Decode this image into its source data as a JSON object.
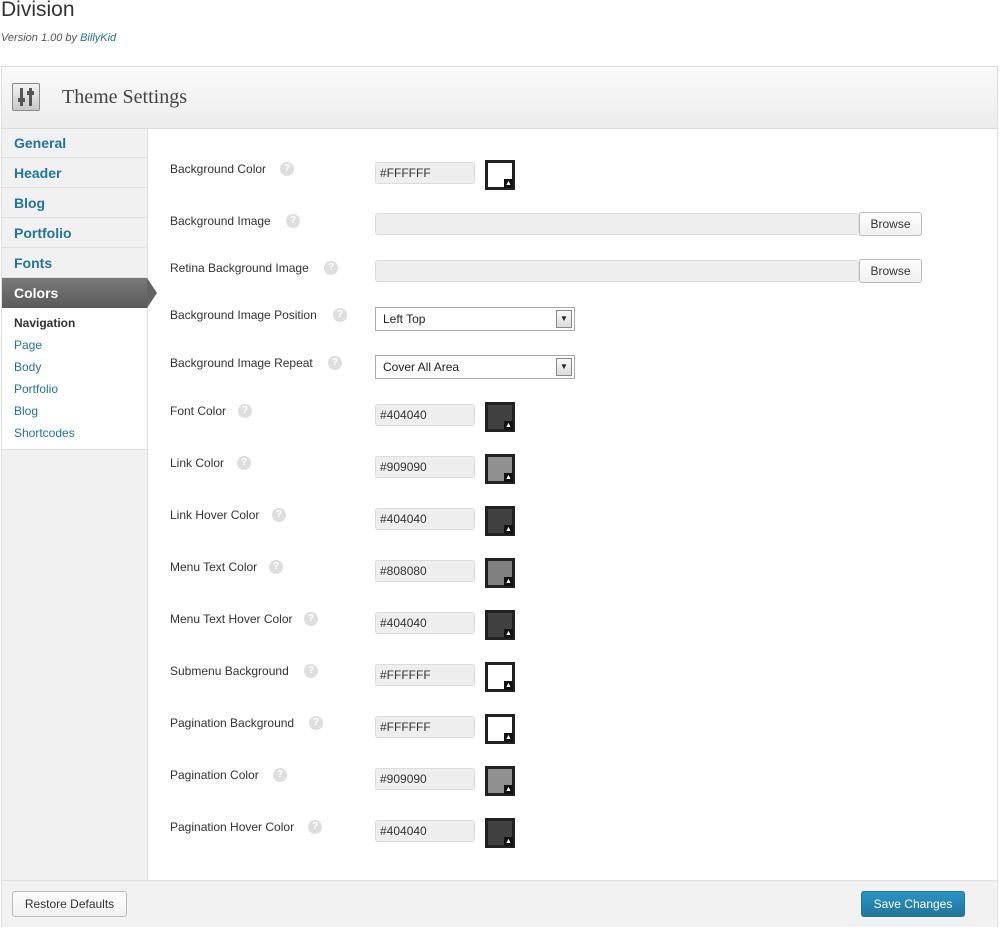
{
  "theme": {
    "name": "Division",
    "version_prefix": "Version 1.00 by",
    "author": "BillyKid"
  },
  "panel": {
    "title": "Theme Settings",
    "icon": "settings-sliders-icon"
  },
  "sidebar": {
    "items": [
      {
        "label": "General"
      },
      {
        "label": "Header"
      },
      {
        "label": "Blog"
      },
      {
        "label": "Portfolio"
      },
      {
        "label": "Fonts"
      },
      {
        "label": "Colors",
        "active": true
      }
    ],
    "subitems": [
      {
        "label": "Navigation",
        "current": true
      },
      {
        "label": "Page"
      },
      {
        "label": "Body"
      },
      {
        "label": "Portfolio"
      },
      {
        "label": "Blog"
      },
      {
        "label": "Shortcodes"
      }
    ]
  },
  "settings": {
    "help_glyph": "?",
    "background_color": {
      "label": "Background Color",
      "value": "#FFFFFF",
      "swatch": "#FFFFFF"
    },
    "background_image": {
      "label": "Background Image",
      "value": "",
      "button": "Browse"
    },
    "retina_background_image": {
      "label": "Retina Background Image",
      "value": "",
      "button": "Browse"
    },
    "background_image_position": {
      "label": "Background Image Position",
      "selected": "Left Top"
    },
    "background_image_repeat": {
      "label": "Background Image Repeat",
      "selected": "Cover All Area"
    },
    "font_color": {
      "label": "Font Color",
      "value": "#404040",
      "swatch": "#404040"
    },
    "link_color": {
      "label": "Link Color",
      "value": "#909090",
      "swatch": "#909090"
    },
    "link_hover_color": {
      "label": "Link Hover Color",
      "value": "#404040",
      "swatch": "#404040"
    },
    "menu_text_color": {
      "label": "Menu Text Color",
      "value": "#808080",
      "swatch": "#808080"
    },
    "menu_text_hover_color": {
      "label": "Menu Text Hover Color",
      "value": "#404040",
      "swatch": "#404040"
    },
    "submenu_background": {
      "label": "Submenu Background",
      "value": "#FFFFFF",
      "swatch": "#FFFFFF"
    },
    "pagination_background": {
      "label": "Pagination Background",
      "value": "#FFFFFF",
      "swatch": "#FFFFFF"
    },
    "pagination_color": {
      "label": "Pagination Color",
      "value": "#909090",
      "swatch": "#909090"
    },
    "pagination_hover_color": {
      "label": "Pagination Hover Color",
      "value": "#404040",
      "swatch": "#404040"
    }
  },
  "footer": {
    "restore_label": "Restore Defaults",
    "save_label": "Save Changes"
  },
  "colors": {
    "link": "#21759b",
    "primary_button": "#21759b",
    "active_nav": "#636363"
  }
}
